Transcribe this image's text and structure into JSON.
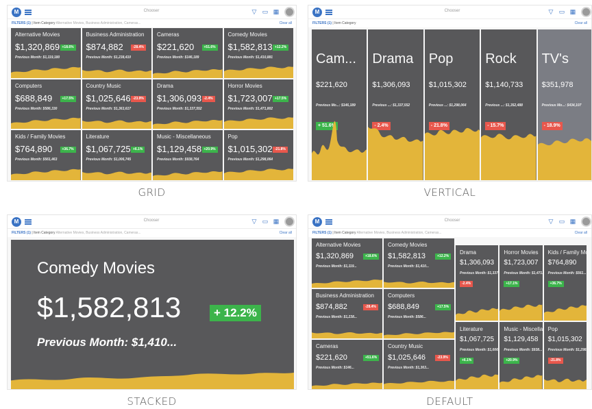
{
  "colors": {
    "tile": "#58585a",
    "tile_highlight": "#7b7d84",
    "area": "#e3b53a",
    "up": "#3cb44b",
    "down": "#e8574c",
    "accent": "#3a73c4"
  },
  "app": {
    "logo": "M",
    "chooser": "Chooser",
    "filters_label": "FILTERS (1)",
    "filter_text": "Item Category",
    "filter_values": "Alternative Movies, Business Administration, Cameras...",
    "clear": "Clear all",
    "icons": [
      "filter-icon",
      "comment-icon",
      "calendar-icon",
      "user-icon"
    ]
  },
  "panels": {
    "grid": {
      "caption": "GRID",
      "tiles": [
        {
          "name": "Alternative Movies",
          "value": "$1,320,869",
          "change": "+18.6%",
          "dir": "up",
          "prev": "Previous Month: $1,119,180"
        },
        {
          "name": "Business Administration",
          "value": "$874,882",
          "change": "-28.4%",
          "dir": "down",
          "prev": "Previous Month: $1,238,410"
        },
        {
          "name": "Cameras",
          "value": "$221,620",
          "change": "+51.6%",
          "dir": "up",
          "prev": "Previous Month: $146,189"
        },
        {
          "name": "Comedy Movies",
          "value": "$1,582,813",
          "change": "+12.2%",
          "dir": "up",
          "prev": "Previous Month: $1,410,881"
        },
        {
          "name": "Computers",
          "value": "$688,849",
          "change": "+17.5%",
          "dir": "up",
          "prev": "Previous Month: $586,330"
        },
        {
          "name": "Country Music",
          "value": "$1,025,646",
          "change": "-23.9%",
          "dir": "down",
          "prev": "Previous Month: $1,363,617"
        },
        {
          "name": "Drama",
          "value": "$1,306,093",
          "change": "-2.4%",
          "dir": "down",
          "prev": "Previous Month: $1,337,552"
        },
        {
          "name": "Horror Movies",
          "value": "$1,723,007",
          "change": "+17.5%",
          "dir": "up",
          "prev": "Previous Month: $1,471,802"
        },
        {
          "name": "Kids / Family Movies",
          "value": "$764,890",
          "change": "+36.7%",
          "dir": "up",
          "prev": "Previous Month: $561,463"
        },
        {
          "name": "Literature",
          "value": "$1,067,725",
          "change": "+6.1%",
          "dir": "up",
          "prev": "Previous Month: $1,006,745"
        },
        {
          "name": "Music - Miscellaneous",
          "value": "$1,129,458",
          "change": "+20.9%",
          "dir": "up",
          "prev": "Previous Month: $938,764"
        },
        {
          "name": "Pop",
          "value": "$1,015,302",
          "change": "-21.8%",
          "dir": "down",
          "prev": "Previous Month: $1,298,064"
        }
      ]
    },
    "vertical": {
      "caption": "VERTICAL",
      "tiles": [
        {
          "name": "Cam...",
          "value": "$221,620",
          "change": "+ 51.6%",
          "dir": "up",
          "prev": "Previous Mo...: $146,189"
        },
        {
          "name": "Drama",
          "value": "$1,306,093",
          "change": "- 2.4%",
          "dir": "down",
          "prev": "Previous ...: $1,337,552"
        },
        {
          "name": "Pop",
          "value": "$1,015,302",
          "change": "- 21.8%",
          "dir": "down",
          "prev": "Previous ...: $1,298,064"
        },
        {
          "name": "Rock",
          "value": "$1,140,733",
          "change": "- 15.7%",
          "dir": "down",
          "prev": "Previous ...: $1,352,488"
        },
        {
          "name": "TV's",
          "value": "$351,978",
          "change": "- 18.9%",
          "dir": "down",
          "prev": "Previous Mo...: $434,107"
        }
      ]
    },
    "stacked": {
      "caption": "STACKED",
      "tile": {
        "name": "Comedy Movies",
        "value": "$1,582,813",
        "change": "+ 12.2%",
        "dir": "up",
        "prev": "Previous Month: $1,410..."
      }
    },
    "default": {
      "caption": "DEFAULT",
      "tiles": [
        {
          "name": "Alternative Movies",
          "value": "$1,320,869",
          "change": "+18.6%",
          "dir": "up",
          "prev": "Previous Month: $1,119..."
        },
        {
          "name": "Comedy Movies",
          "value": "$1,582,813",
          "change": "+12.2%",
          "dir": "up",
          "prev": "Previous Month: $1,410..."
        },
        {
          "name": "Drama",
          "value": "$1,306,093",
          "change": "-2.4%",
          "dir": "down",
          "prev": "Previous Month: $1,337..."
        },
        {
          "name": "Horror Movies",
          "value": "$1,723,007",
          "change": "+17.1%",
          "dir": "up",
          "prev": "Previous Month: $1,471..."
        },
        {
          "name": "Kids / Family Movies",
          "value": "$764,890",
          "change": "+36.7%",
          "dir": "up",
          "prev": "Previous Month: $561..."
        },
        {
          "name": "Business Administration",
          "value": "$874,882",
          "change": "-28.4%",
          "dir": "down",
          "prev": "Previous Month: $1,238..."
        },
        {
          "name": "Computers",
          "value": "$688,849",
          "change": "+17.5%",
          "dir": "up",
          "prev": "Previous Month: $586..."
        },
        {
          "name": "Literature",
          "value": "$1,067,725",
          "change": "+6.1%",
          "dir": "up",
          "prev": "Previous Month: $1,006..."
        },
        {
          "name": "Music - Miscellaneous",
          "value": "$1,129,458",
          "change": "+20.9%",
          "dir": "up",
          "prev": "Previous Month: $938..."
        },
        {
          "name": "Pop",
          "value": "$1,015,302",
          "change": "-21.8%",
          "dir": "down",
          "prev": "Previous Month: $1,298..."
        },
        {
          "name": "Cameras",
          "value": "$221,620",
          "change": "+51.6%",
          "dir": "up",
          "prev": "Previous Month: $146..."
        },
        {
          "name": "Country Music",
          "value": "$1,025,646",
          "change": "-23.9%",
          "dir": "down",
          "prev": "Previous Month: $1,363..."
        }
      ]
    }
  }
}
